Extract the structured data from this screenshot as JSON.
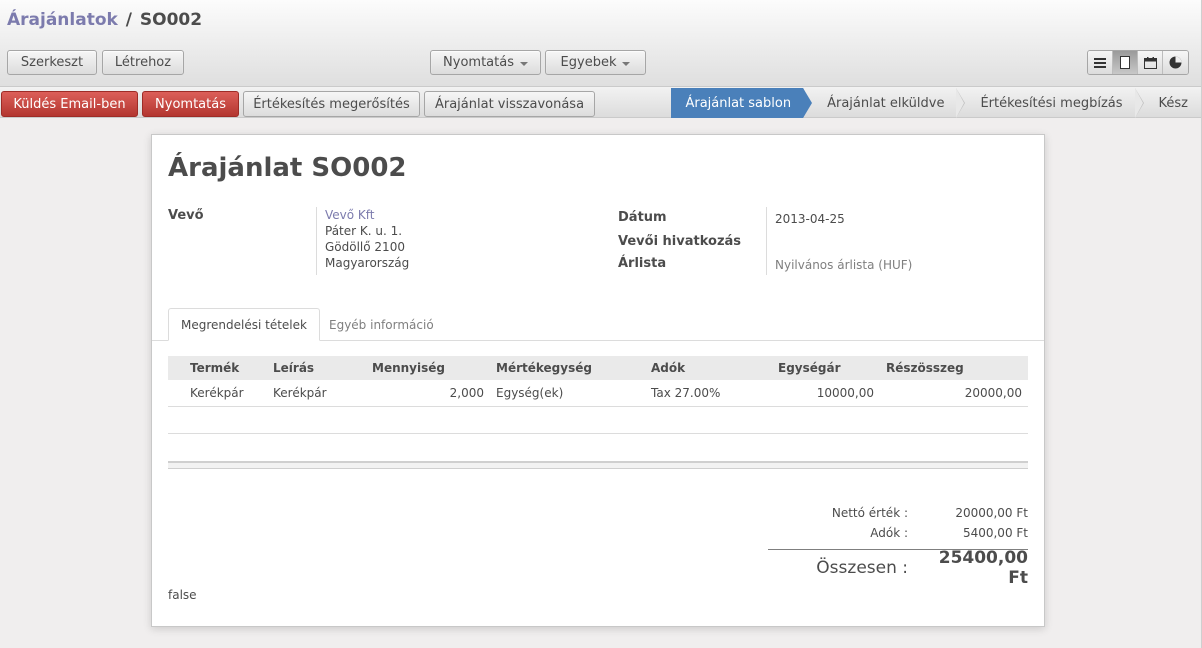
{
  "breadcrumb": {
    "parent": "Árajánlatok",
    "separator": "/",
    "current": "SO002"
  },
  "toolbar": {
    "edit": "Szerkeszt",
    "create": "Létrehoz",
    "print": "Nyomtatás",
    "more": "Egyebek"
  },
  "actions": {
    "send_email": "Küldés Email-ben",
    "print": "Nyomtatás",
    "confirm_sale": "Értékesítés megerősítés",
    "cancel_quote": "Árajánlat visszavonása"
  },
  "status": {
    "stages": [
      "Árajánlat sablon",
      "Árajánlat elküldve",
      "Értékesítési megbízás",
      "Kész"
    ],
    "active": "Árajánlat sablon"
  },
  "form": {
    "title": "Árajánlat SO002",
    "customer_label": "Vevő",
    "customer_name": "Vevő Kft",
    "address_line1": "Páter K. u. 1.",
    "address_line2": "Gödöllő 2100",
    "address_country": "Magyarország",
    "date_label": "Dátum",
    "date_value": "2013-04-25",
    "customer_ref_label": "Vevői hivatkozás",
    "pricelist_label": "Árlista",
    "pricelist_value": "Nyilvános árlista (HUF)"
  },
  "tabs": {
    "order_lines": "Megrendelési tételek",
    "other_info": "Egyéb információ"
  },
  "lines": {
    "headers": [
      "Termék",
      "Leírás",
      "Mennyiség",
      "Mértékegység",
      "Adók",
      "Egységár",
      "Részösszeg"
    ],
    "rows": [
      [
        "Kerékpár",
        "Kerékpár",
        "2,000",
        "Egység(ek)",
        "Tax 27.00%",
        "10000,00",
        "20000,00"
      ]
    ]
  },
  "totals": {
    "net_label": "Nettó érték :",
    "net_value": "20000,00 Ft",
    "tax_label": "Adók :",
    "tax_value": "5400,00 Ft",
    "total_label": "Összesen :",
    "total_value": "25400,00 Ft"
  },
  "note": "false",
  "colors": {
    "accent": "#7c7bad",
    "danger": "#c9453f",
    "stage_active": "#4a80ba"
  }
}
